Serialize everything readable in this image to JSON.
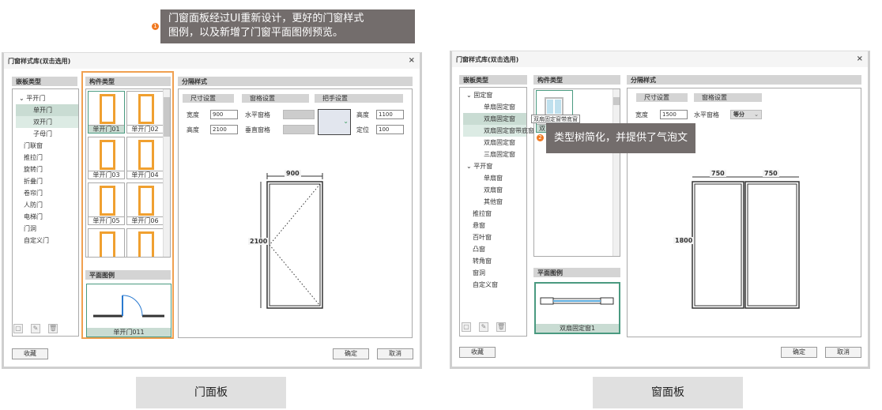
{
  "callout1": {
    "badge": "1",
    "text_line1": "门窗面板经过UI重新设计，更好的门窗样式",
    "text_line2": "图例，以及新增了门窗平面图例预览。"
  },
  "callout2": {
    "badge": "2",
    "text": "类型树简化，并提供了气泡文字说明"
  },
  "door_panel": {
    "title": "门窗样式库(双击选用)",
    "close": "×",
    "panel_type_header": "嵌板类型",
    "tree": [
      "平开门",
      "单开门",
      "双开门",
      "子母门",
      "门联窗",
      "推拉门",
      "旋转门",
      "折叠门",
      "卷帘门",
      "人防门",
      "电梯门",
      "门洞",
      "自定义门"
    ],
    "component_header": "构件类型",
    "components": [
      "单开门01",
      "单开门02",
      "单开门03",
      "单开门04",
      "单开门05",
      "单开门06"
    ],
    "plan_header": "平面图例",
    "plan_caption": "单开门011",
    "divider_header": "分隔样式",
    "size_tab": "尺寸设置",
    "pane_tab": "窗格设置",
    "handle_tab": "把手设置",
    "width_label": "宽度",
    "width": "900",
    "height_label": "高度",
    "height": "2100",
    "h_pane_label": "水平窗格",
    "v_pane_label": "垂直窗格",
    "handle_height_label": "高度",
    "handle_height": "1100",
    "handle_pos_label": "定位",
    "handle_pos": "100",
    "dim_width": "900",
    "dim_height": "2100",
    "fav": "收藏",
    "ok": "确定",
    "cancel": "取消"
  },
  "window_panel": {
    "title": "门窗样式库(双击选用)",
    "close": "×",
    "panel_type_header": "嵌板类型",
    "tree": [
      "固定窗",
      "单扇固定窗",
      "双扇固定窗",
      "双扇固定窗带底窗",
      "双扇固定窗",
      "三扇固定窗",
      "平开窗",
      "单扇窗",
      "双扇窗",
      "其他窗",
      "推拉窗",
      "悬窗",
      "百叶窗",
      "凸窗",
      "转角窗",
      "窗洞",
      "自定义窗"
    ],
    "tooltip": "双扇固定窗带底窗",
    "component_header": "构件类型",
    "component_caption": "双",
    "plan_header": "平面图例",
    "plan_caption": "双扇固定窗1",
    "divider_header": "分隔样式",
    "size_tab": "尺寸设置",
    "pane_tab": "窗格设置",
    "width_label": "宽度",
    "width": "1500",
    "h_pane_label": "水平窗格",
    "h_pane_value": "等分",
    "dim_left": "750",
    "dim_right": "750",
    "dim_height": "1800",
    "fav": "收藏",
    "ok": "确定",
    "cancel": "取消"
  },
  "labels": {
    "door": "门面板",
    "window": "窗面板"
  }
}
